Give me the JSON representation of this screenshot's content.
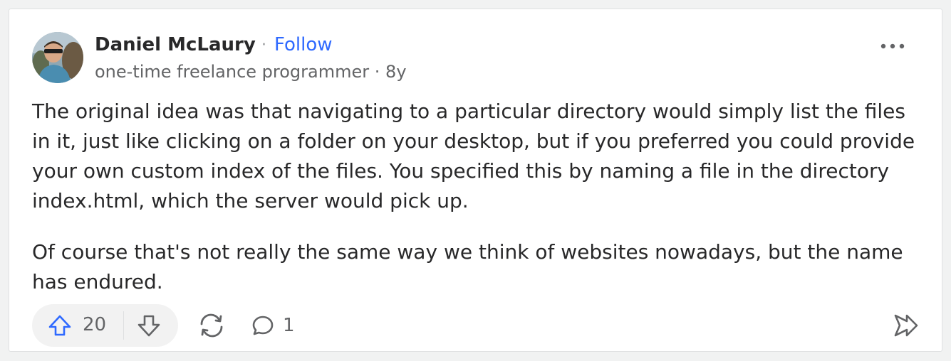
{
  "author": {
    "name": "Daniel McLaury",
    "separator": "·",
    "follow_label": "Follow",
    "credential": "one-time freelance programmer",
    "age": "8y",
    "avatar_icon": "user-avatar-photo"
  },
  "answer": {
    "paragraphs": [
      "The original idea was that navigating to a particular directory would simply list the files in it, just like clicking on a folder on your desktop, but if you preferred you could provide your own custom index of the files. You specified this by naming a file in the directory index.html, which the server would pick up.",
      "Of course that's not really the same way we think of websites nowadays, but the name has endured."
    ]
  },
  "actions": {
    "upvote_count": "20",
    "comment_count": "1",
    "icons": [
      "upvote-arrow-icon",
      "downvote-arrow-icon",
      "share-cycle-icon",
      "comment-bubble-icon",
      "forward-icon",
      "more-dots-icon"
    ]
  },
  "colors": {
    "accent": "#2e69ff",
    "text": "#282829",
    "muted": "#636466"
  }
}
